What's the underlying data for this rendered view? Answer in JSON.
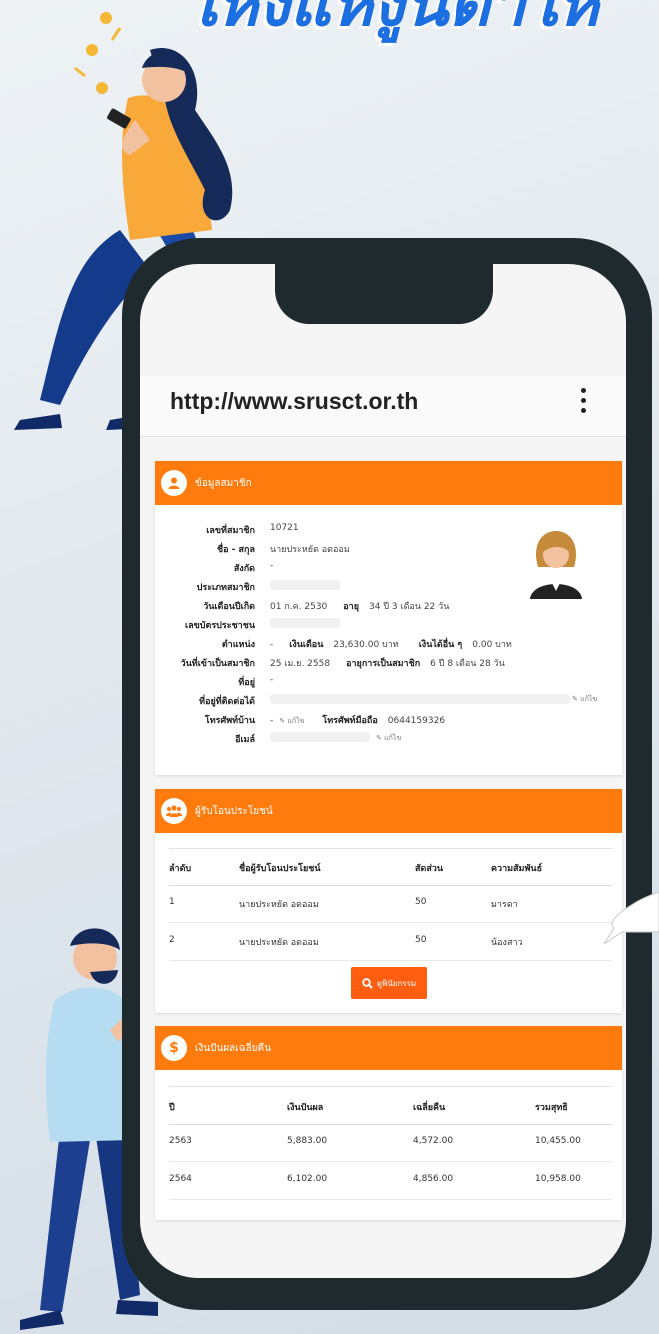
{
  "headline": "ให้งแห้งูนต่ำให้",
  "browser": {
    "url": "http://www.srusct.or.th",
    "menu_icon": "kebab-menu-icon"
  },
  "member_card": {
    "title": "ข้อมูลสมาชิก",
    "icon": "user-icon",
    "rows": [
      {
        "label": "เลขที่สมาชิก",
        "value": "10721"
      },
      {
        "label": "ชื่อ - สกุล",
        "value": "นายประหยัด อดออม"
      },
      {
        "label": "สังกัด",
        "value": "-"
      },
      {
        "label": "ประเภทสมาชิก",
        "value": ""
      },
      {
        "label": "วันเดือนปีเกิด",
        "value": "01 ก.ค. 2530",
        "extra_label": "อายุ",
        "extra_value": "34 ปี 3 เดือน 22 วัน"
      },
      {
        "label": "เลขบัตรประชาชน",
        "value": ""
      },
      {
        "label": "ตำแหน่ง",
        "value": "-",
        "extra_label": "เงินเดือน",
        "extra_value": "23,630.00 บาท",
        "extra2_label": "เงินได้อื่น ๆ",
        "extra2_value": "0.00 บาท"
      },
      {
        "label": "วันที่เข้าเป็นสมาชิก",
        "value": "25 เม.ย. 2558",
        "extra_label": "อายุการเป็นสมาชิก",
        "extra_value": "6 ปี 8 เดือน 28 วัน"
      },
      {
        "label": "ที่อยู่",
        "value": "-"
      },
      {
        "label": "ที่อยู่ที่ติดต่อได้",
        "value": "",
        "edit": "แก้ไข"
      },
      {
        "label": "โทรศัพท์บ้าน",
        "value": "-",
        "edit": "แก้ไข",
        "extra_label": "โทรศัพท์มือถือ",
        "extra_value": "0644159326"
      },
      {
        "label": "อีเมล์",
        "value": "",
        "edit": "แก้ไข"
      }
    ]
  },
  "beneficiary_card": {
    "title": "ผู้รับโอนประโยชน์",
    "icon": "group-icon",
    "headers": [
      "ลำดับ",
      "ชื่อผู้รับโอนประโยชน์",
      "สัดส่วน",
      "ความสัมพันธ์"
    ],
    "rows": [
      [
        "1",
        "นายประหยัด อดออม",
        "50",
        "มารดา"
      ],
      [
        "2",
        "นายประหยัด อดออม",
        "50",
        "น้องสาว"
      ]
    ],
    "button_label": "ดูพินัยกรรม",
    "button_icon": "search-icon"
  },
  "dividend_card": {
    "title": "เงินปันผลเฉลี่ยคืน",
    "icon": "dollar-icon",
    "headers": [
      "ปี",
      "เงินปันผล",
      "เฉลี่ยคืน",
      "รวมสุทธิ"
    ],
    "rows": [
      [
        "2563",
        "5,883.00",
        "4,572.00",
        "10,455.00"
      ],
      [
        "2564",
        "6,102.00",
        "4,856.00",
        "10,958.00"
      ]
    ]
  },
  "colors": {
    "accent": "#ff7b0d",
    "button": "#ff5e10",
    "phone": "#1e2a2e"
  }
}
